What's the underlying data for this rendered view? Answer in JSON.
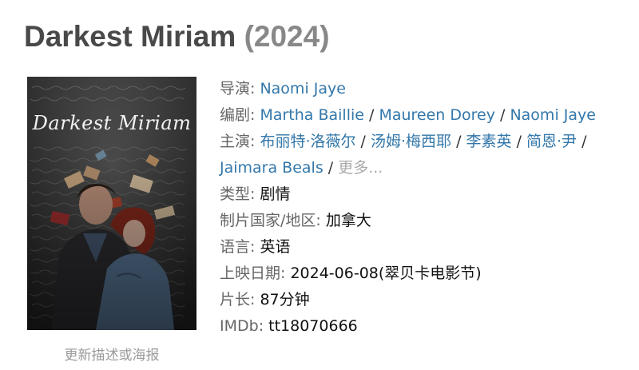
{
  "title": {
    "name": "Darkest Miriam",
    "year": "(2024)"
  },
  "poster": {
    "title_text": "Darkest Miriam"
  },
  "update_link": "更新描述或海报",
  "info": {
    "director_label": "导演: ",
    "director": "Naomi Jaye",
    "writer_label": "编剧: ",
    "writers": [
      "Martha Baillie",
      "Maureen Dorey",
      "Naomi Jaye"
    ],
    "cast_label": "主演: ",
    "cast": [
      "布丽特·洛薇尔",
      "汤姆·梅西耶",
      "李素英",
      "简恩·尹",
      "Jaimara Beals"
    ],
    "more": "更多...",
    "separator": " / ",
    "genre_label": "类型: ",
    "genre": "剧情",
    "country_label": "制片国家/地区: ",
    "country": "加拿大",
    "language_label": "语言: ",
    "language": "英语",
    "release_label": "上映日期: ",
    "release": "2024-06-08(翠贝卡电影节)",
    "runtime_label": "片长: ",
    "runtime": "87分钟",
    "imdb_label": "IMDb: ",
    "imdb": "tt18070666"
  },
  "colors": {
    "link": "#3377aa",
    "label": "#666666",
    "title": "#494949",
    "year": "#888888"
  }
}
